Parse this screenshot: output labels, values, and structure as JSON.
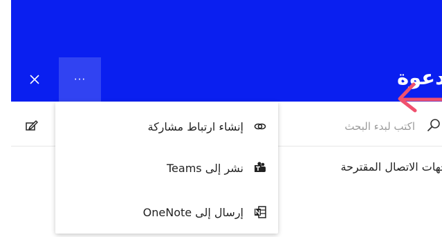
{
  "header": {
    "title": "دعوة",
    "more_label": "···",
    "colors": {
      "background": "#0a1ff0",
      "annotation_arrow": "#f0506e"
    }
  },
  "search": {
    "placeholder": "اكتب لبدء البحث"
  },
  "section": {
    "title": "جهات الاتصال المقترحة"
  },
  "menu": {
    "items": [
      {
        "label": "إنشاء ارتباط مشاركة",
        "icon": "link-icon"
      },
      {
        "label": "نشر إلى Teams",
        "icon": "teams-icon"
      },
      {
        "label": "إرسال إلى OneNote",
        "icon": "onenote-icon"
      }
    ]
  },
  "icons": {
    "close": "close-icon",
    "edit": "edit-icon",
    "search": "search-icon",
    "arrow": "arrow-annotation-icon"
  }
}
